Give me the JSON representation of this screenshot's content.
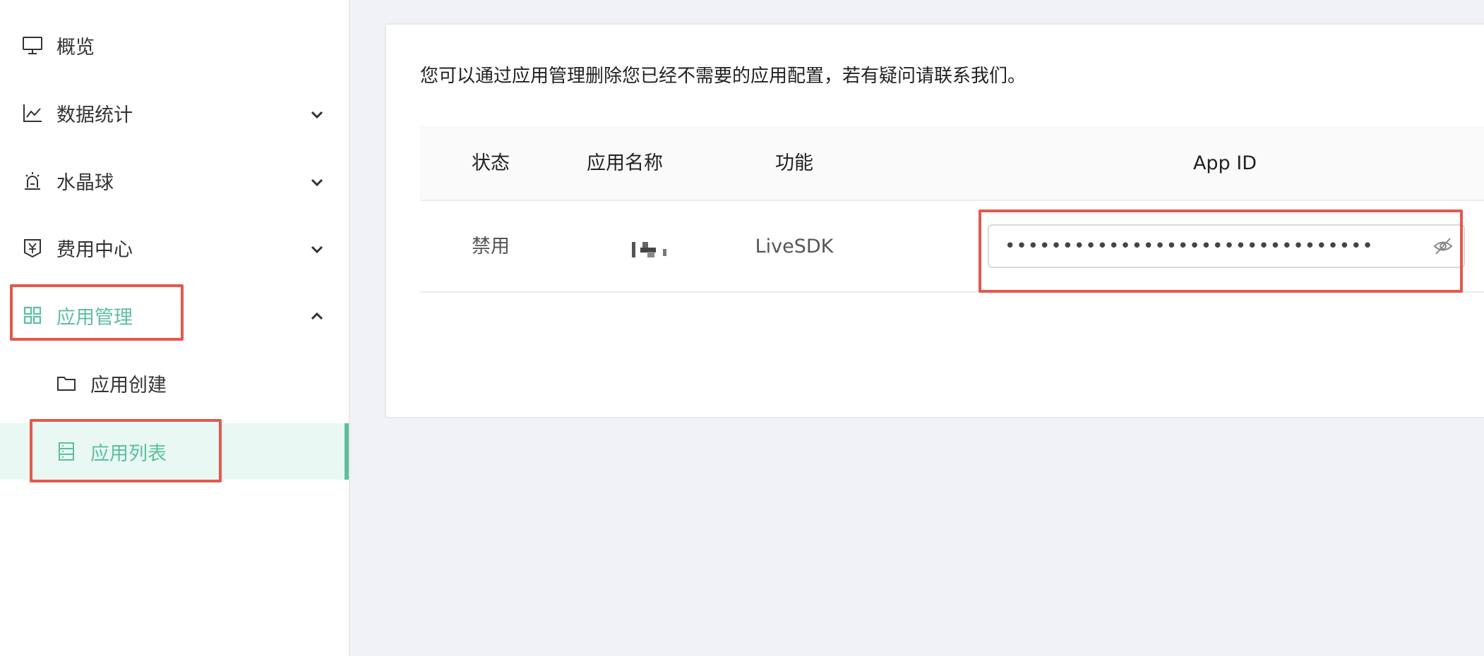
{
  "sidebar": {
    "items": [
      {
        "label": "概览",
        "icon": "monitor-icon"
      },
      {
        "label": "数据统计",
        "icon": "line-chart-icon"
      },
      {
        "label": "水晶球",
        "icon": "alarm-icon"
      },
      {
        "label": "费用中心",
        "icon": "yen-shield-icon"
      },
      {
        "label": "应用管理",
        "icon": "grid-icon"
      }
    ],
    "sub_items": [
      {
        "label": "应用创建",
        "icon": "folder-icon"
      },
      {
        "label": "应用列表",
        "icon": "list-icon"
      }
    ],
    "accent_color": "#5cbf9e",
    "highlight_color": "#e3594d"
  },
  "main": {
    "notice": "您可以通过应用管理删除您已经不需要的应用配置，若有疑问请联系我们。",
    "table": {
      "columns": [
        "状态",
        "应用名称",
        "功能",
        "App ID"
      ],
      "rows": [
        {
          "status": "禁用",
          "feature": "LiveSDK",
          "app_id": "••••••••••••••••••••••••••••••••"
        }
      ]
    }
  }
}
